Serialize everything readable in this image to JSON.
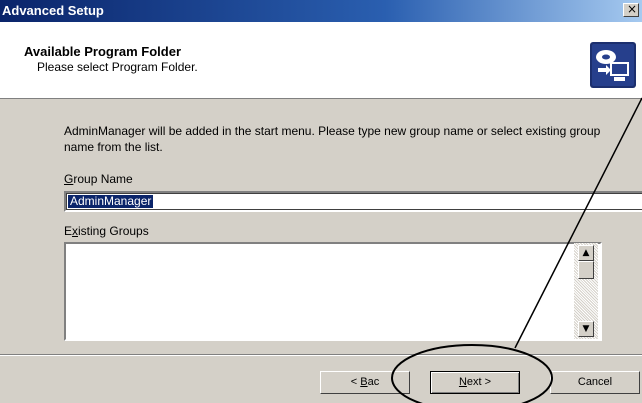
{
  "window": {
    "title": "Advanced Setup",
    "close_glyph": "×"
  },
  "header": {
    "title": "Available Program Folder",
    "subtitle": "Please select Program Folder.",
    "icon": "setup-wizard-icon"
  },
  "body": {
    "description": "AdminManager will be added in the start menu. Please type new group name or select existing group name from the list.",
    "group_name_label_prefix": "",
    "group_name_label_mnemonic": "G",
    "group_name_label_rest": "roup Name",
    "group_name_value": "AdminManager",
    "existing_groups_label_prefix": "E",
    "existing_groups_label_mnemonic": "x",
    "existing_groups_label_rest": "isting Groups",
    "existing_groups_items": []
  },
  "buttons": {
    "back_prefix": "< ",
    "back_mnemonic": "B",
    "back_rest": "ac",
    "next_mnemonic": "N",
    "next_rest": "ext >",
    "cancel": "Cancel"
  },
  "scrollbar": {
    "up_glyph": "▲",
    "down_glyph": "▼"
  },
  "colors": {
    "titlebar": "#0a246a",
    "selection": "#0a246a",
    "face": "#d4d0c8"
  }
}
